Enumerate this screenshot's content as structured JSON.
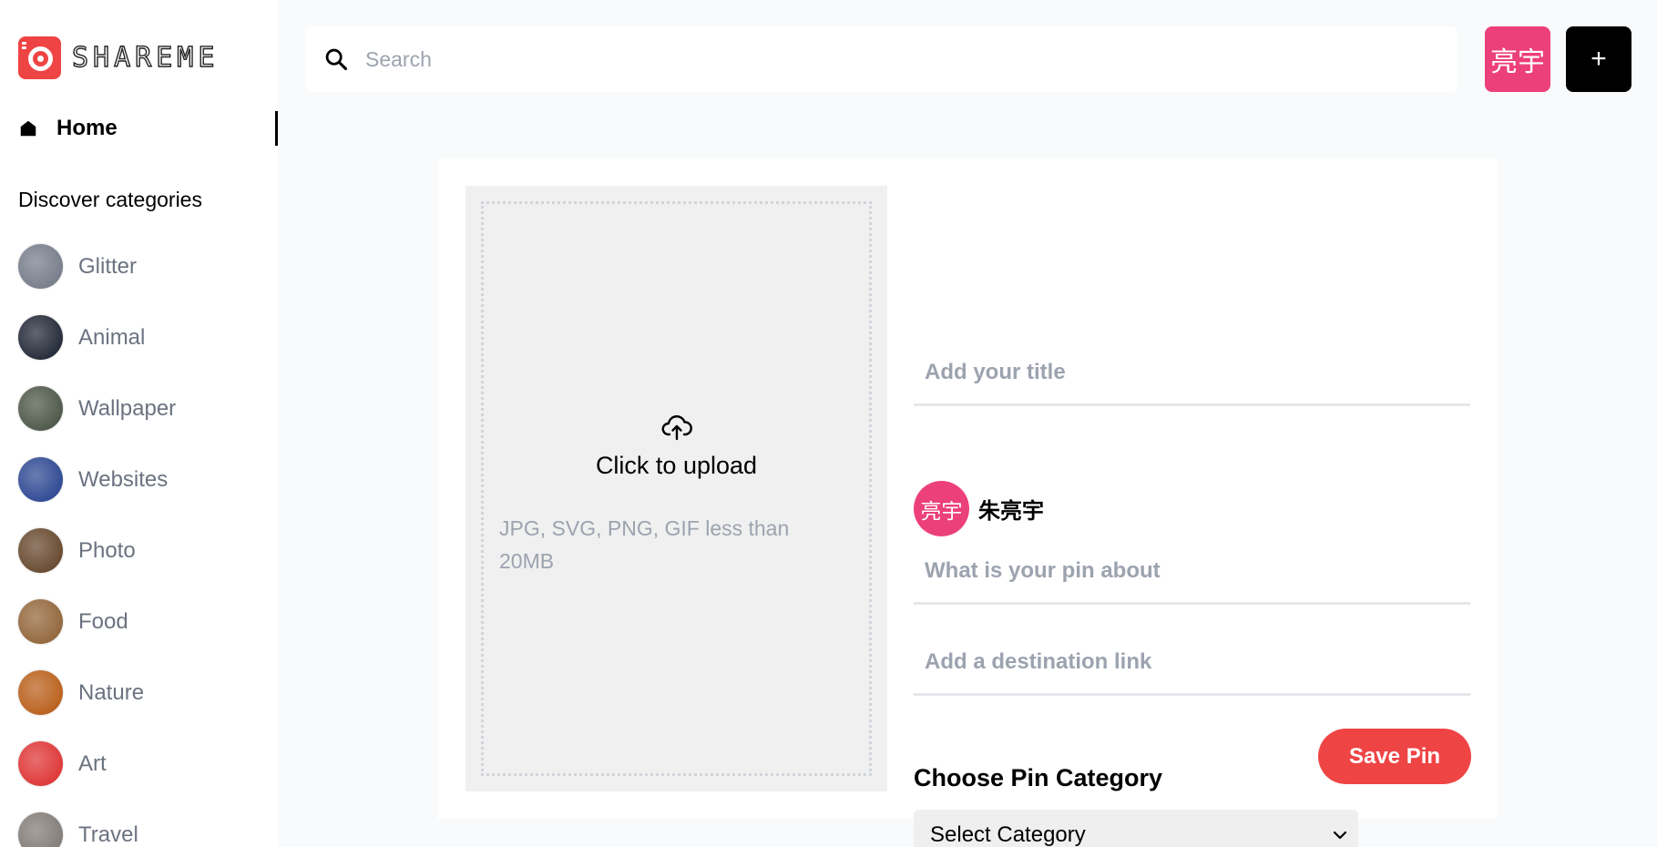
{
  "app": {
    "logo_text": "SHAREME"
  },
  "sidebar": {
    "home_label": "Home",
    "discover_heading": "Discover categories",
    "categories": [
      {
        "label": "Glitter",
        "color": "#6b7280"
      },
      {
        "label": "Animal",
        "color": "#111827"
      },
      {
        "label": "Wallpaper",
        "color": "#3f4a3a"
      },
      {
        "label": "Websites",
        "color": "#1e3a8a"
      },
      {
        "label": "Photo",
        "color": "#5b3a1e"
      },
      {
        "label": "Food",
        "color": "#8a5a2b"
      },
      {
        "label": "Nature",
        "color": "#b45309"
      },
      {
        "label": "Art",
        "color": "#dc2626"
      },
      {
        "label": "Travel",
        "color": "#78716c"
      }
    ]
  },
  "header": {
    "search_placeholder": "Search",
    "user_avatar_text": "亮宇",
    "add_button_label": "+"
  },
  "upload": {
    "title": "Click to upload",
    "hint": "JPG, SVG, PNG, GIF less than 20MB"
  },
  "form": {
    "title_placeholder": "Add your title",
    "author_avatar_text": "亮宇",
    "author_name": "朱亮宇",
    "about_placeholder": "What is your pin about",
    "destination_placeholder": "Add a destination link",
    "category_heading": "Choose Pin Category",
    "category_selected": "Select Category",
    "save_label": "Save Pin"
  },
  "colors": {
    "accent": "#ef4444",
    "avatar": "#ec407a"
  }
}
